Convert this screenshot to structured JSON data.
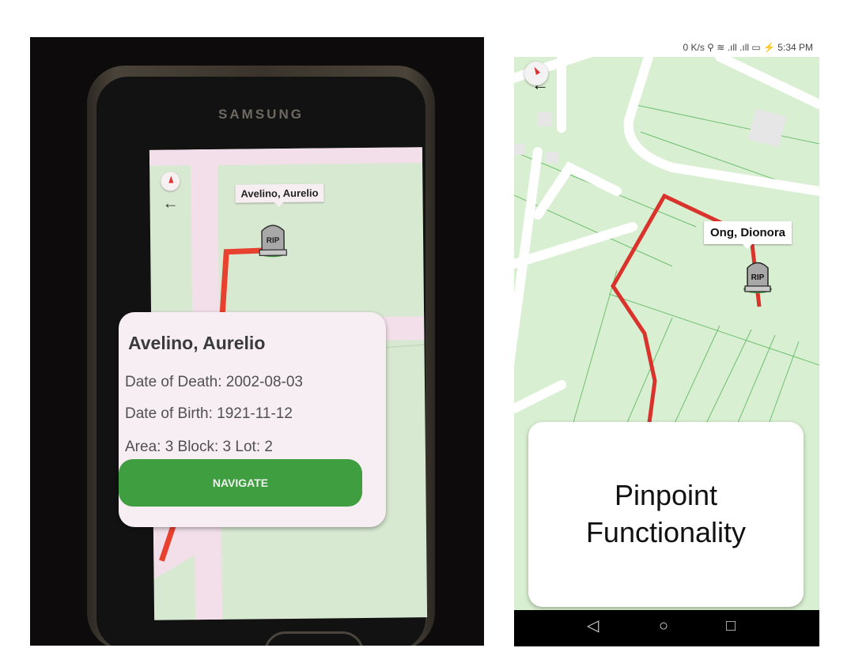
{
  "left_photo": {
    "brand": "SAMSUNG",
    "grave_label": "Avelino, Aurelio",
    "tombstone_text": "RIP",
    "back_glyph": "←",
    "card": {
      "name": "Avelino, Aurelio",
      "date_of_death": "Date of Death: 2002-08-03",
      "date_of_birth": "Date of Birth: 1921-11-12",
      "location": "Area: 3 Block: 3 Lot: 2",
      "navigate_label": "NAVIGATE"
    },
    "back_key_glyph": "⮌"
  },
  "right_screenshot": {
    "status_bar": "0 K/s ⚲ ≋ .ıll .ıll ▭ ⚡ 5:34 PM",
    "back_glyph": "←",
    "grave_label": "Ong, Dionora",
    "tombstone_text": "RIP",
    "caption": {
      "line1": "Pinpoint",
      "line2": "Functionality"
    },
    "nav": {
      "back": "◁",
      "home": "○",
      "recents": "□"
    }
  },
  "colors": {
    "route": "#d9332c",
    "map_green": "#d9efd1",
    "road_white": "#ffffff",
    "navigate_button": "#3f9e3f",
    "tombstone_gray": "#9a9a9a"
  }
}
